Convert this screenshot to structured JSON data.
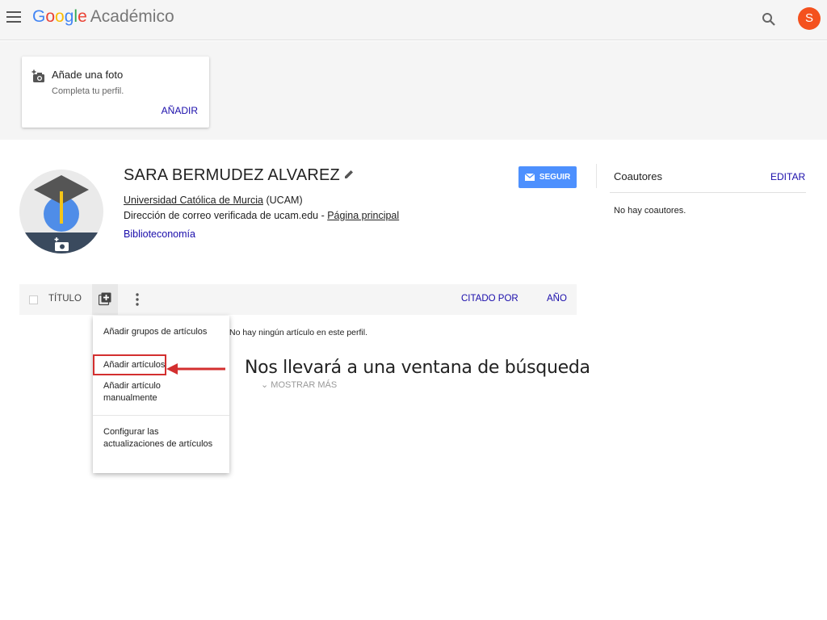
{
  "header": {
    "logo_google": [
      "G",
      "o",
      "o",
      "g",
      "l",
      "e"
    ],
    "logo_product": "Académico",
    "avatar_initial": "S",
    "icons": {
      "menu": "menu-icon",
      "search": "search-icon"
    }
  },
  "photo_card": {
    "title": "Añade una foto",
    "subtitle": "Completa tu perfil.",
    "action": "AÑADIR"
  },
  "profile": {
    "name": "SARA BERMUDEZ ALVAREZ",
    "affiliation_link": "Universidad Católica de Murcia",
    "affiliation_suffix": " (UCAM)",
    "email_text": "Dirección de correo verificada de ucam.edu - ",
    "homepage_link": "Página principal",
    "interest": "Biblioteconomía",
    "follow_label": "SEGUIR"
  },
  "coauthors": {
    "heading": "Coautores",
    "edit": "EDITAR",
    "empty": "No hay coautores."
  },
  "articles": {
    "col_title": "TÍTULO",
    "col_cited": "CITADO POR",
    "col_year": "AÑO",
    "empty": "No hay ningún artículo en este perfil.",
    "show_more": "MOSTRAR MÁS"
  },
  "dropdown": {
    "items": [
      "Añadir grupos de artículos",
      "Añadir artículos",
      "Añadir artículo manualmente",
      "Configurar las actualizaciones de artículos"
    ]
  },
  "annotation": "Nos llevará a una ventana de búsqueda",
  "colors": {
    "accent": "#4d90fe",
    "link": "#1a0dab",
    "avatar": "#f4511e",
    "highlight": "#d32f2f"
  }
}
